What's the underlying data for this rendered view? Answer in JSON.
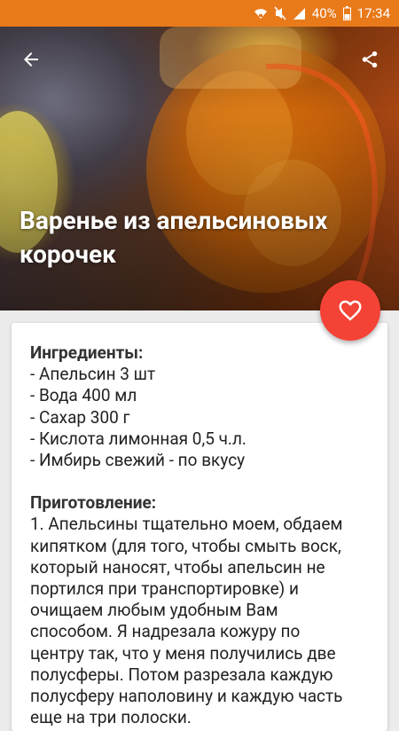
{
  "status_bar": {
    "battery": "40%",
    "time": "17:34",
    "icons": [
      "wifi-icon",
      "mute-icon",
      "signal-icon",
      "battery-icon"
    ],
    "color": "#e97a1a"
  },
  "header": {
    "title": "Варенье из апельсиновых корочек",
    "back_icon": "arrow-back-icon",
    "share_icon": "share-icon"
  },
  "favorite": {
    "icon": "heart-outline-icon",
    "color": "#f44336"
  },
  "recipe": {
    "ingredients_title": "Ингредиенты:",
    "ingredients": [
      "- Апельсин 3 шт",
      "- Вода 400 мл",
      "- Сахар 300 г",
      "- Кислота лимонная 0,5 ч.л.",
      "- Имбирь свежий - по вкусу"
    ],
    "preparation_title": "Приготовление:",
    "preparation_lines": [
      "1. Апельсины тщательно моем, обдаем",
      "кипятком (для того, чтобы смыть воск,",
      "который наносят, чтобы апельсин не",
      "портился при транспортировке) и",
      "очищаем любым удобным Вам",
      "способом. Я надрезала кожуру по",
      "центру так, что у меня получились две",
      "полусферы. Потом разрезала каждую",
      "полусферу наполовину и каждую часть",
      "еще на три полоски."
    ]
  }
}
